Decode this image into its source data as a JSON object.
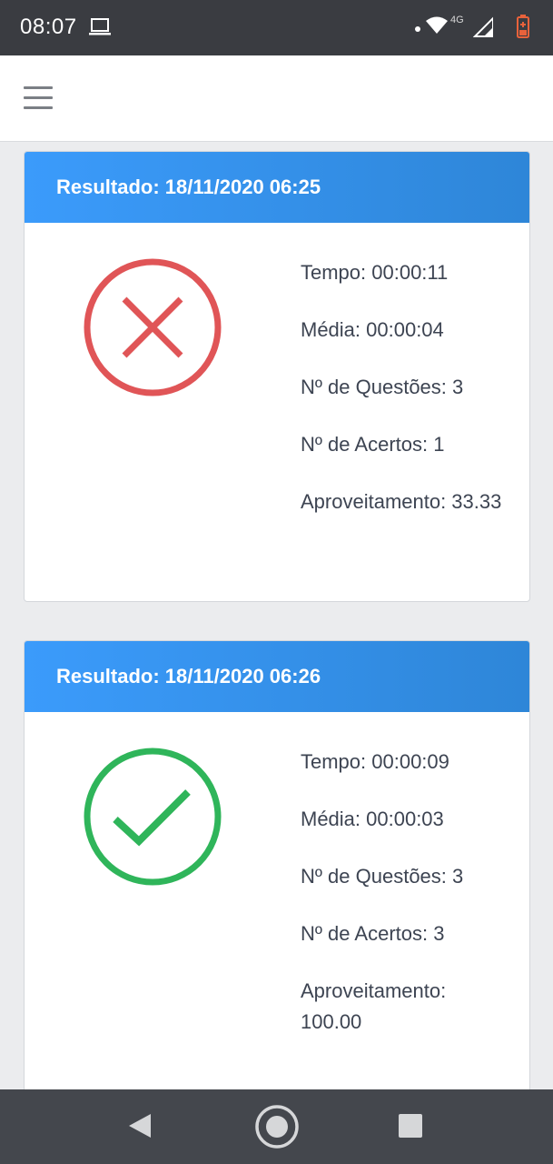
{
  "status_bar": {
    "time": "08:07",
    "network_label": "4G",
    "icons": [
      "laptop-icon",
      "notification-dot-icon",
      "wifi-icon",
      "signal-icon",
      "battery-icon"
    ]
  },
  "top_bar": {
    "menu_icon": "hamburger-menu-icon"
  },
  "results": [
    {
      "title": "Resultado: 18/11/2020 06:25",
      "status_icon": "error-x-icon",
      "status_color": "#e05557",
      "tempo": "Tempo: 00:00:11",
      "media": "Média: 00:00:04",
      "questoes": "Nº de Questões: 3",
      "acertos": "Nº de Acertos: 1",
      "aproveitamento": "Aproveitamento: 33.33"
    },
    {
      "title": "Resultado: 18/11/2020 06:26",
      "status_icon": "success-check-icon",
      "status_color": "#2fb55a",
      "tempo": "Tempo: 00:00:09",
      "media": "Média: 00:00:03",
      "questoes": "Nº de Questões: 3",
      "acertos": "Nº de Acertos: 3",
      "aproveitamento": "Aproveitamento: 100.00"
    }
  ],
  "colors": {
    "header_gradient_start": "#3b9bfb",
    "header_gradient_end": "#2e86d8",
    "page_background": "#ebecee"
  },
  "nav_bar": {
    "icons": [
      "back-icon",
      "home-icon",
      "recent-apps-icon"
    ]
  }
}
